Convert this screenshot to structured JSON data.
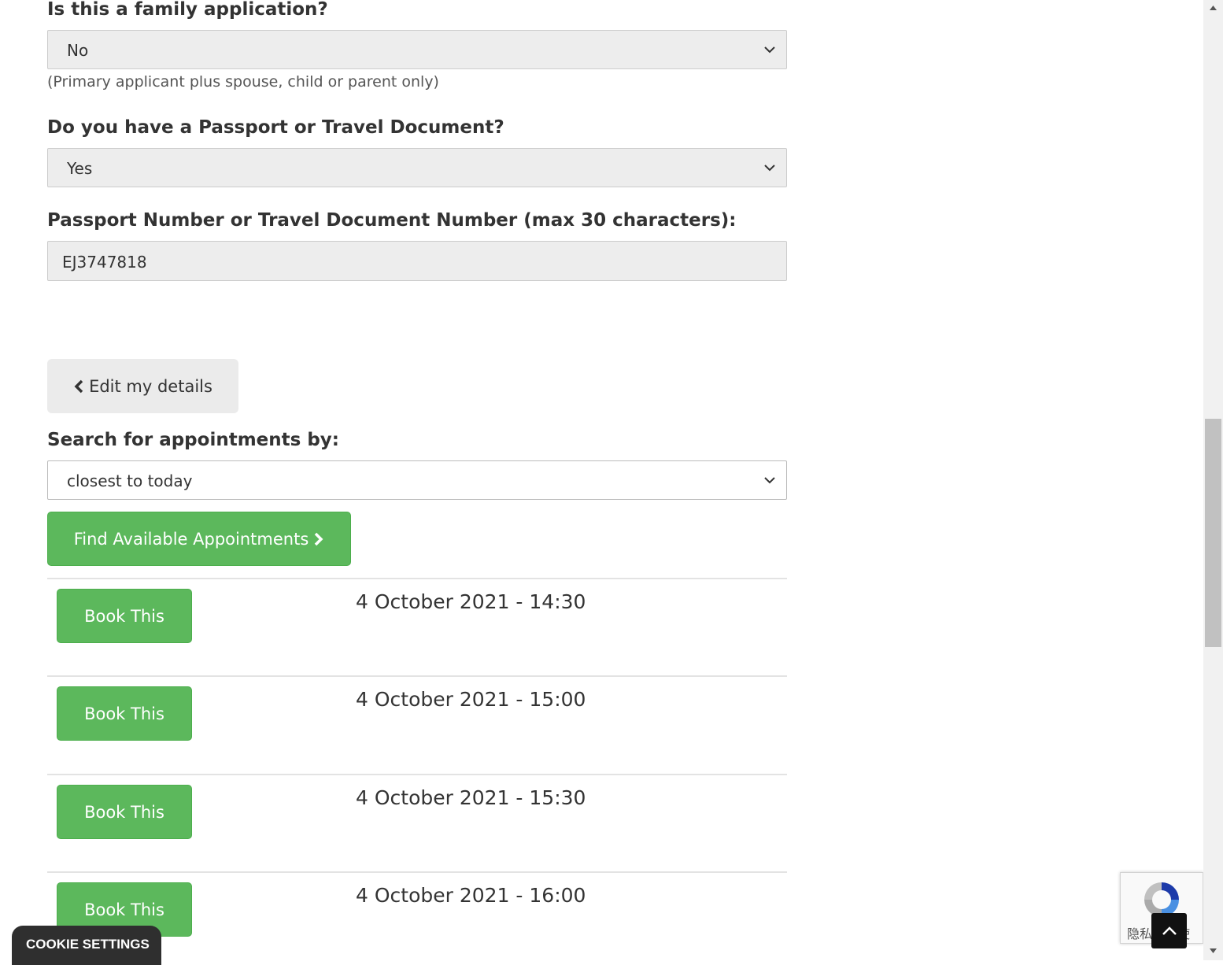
{
  "form": {
    "family_label": "Is this a family application?",
    "family_value": "No",
    "family_help": "(Primary applicant plus spouse, child or parent only)",
    "passport_label": "Do you have a Passport or Travel Document?",
    "passport_value": "Yes",
    "passport_number_label": "Passport Number or Travel Document Number (max 30 characters):",
    "passport_number_value": "EJ3747818"
  },
  "edit_button": {
    "label": "Edit my details",
    "icon": "chevron-left-icon"
  },
  "search": {
    "label": "Search for appointments by:",
    "value": "closest to today",
    "find_button": "Find Available Appointments",
    "find_icon": "chevron-right-icon"
  },
  "appointments": [
    {
      "button": "Book This",
      "time": "4 October 2021 - 14:30"
    },
    {
      "button": "Book This",
      "time": "4 October 2021 - 15:00"
    },
    {
      "button": "Book This",
      "time": "4 October 2021 - 15:30"
    },
    {
      "button": "Book This",
      "time": "4 October 2021 - 16:00"
    }
  ],
  "cookie_settings": "COOKIE SETTINGS",
  "recaptcha": {
    "text": "隐私权 - 使",
    "icon": "recaptcha-logo-icon"
  },
  "back_to_top_icon": "chevron-up-icon",
  "colors": {
    "green": "#5cb85c",
    "field_bg": "#ededed",
    "text": "#333333"
  }
}
